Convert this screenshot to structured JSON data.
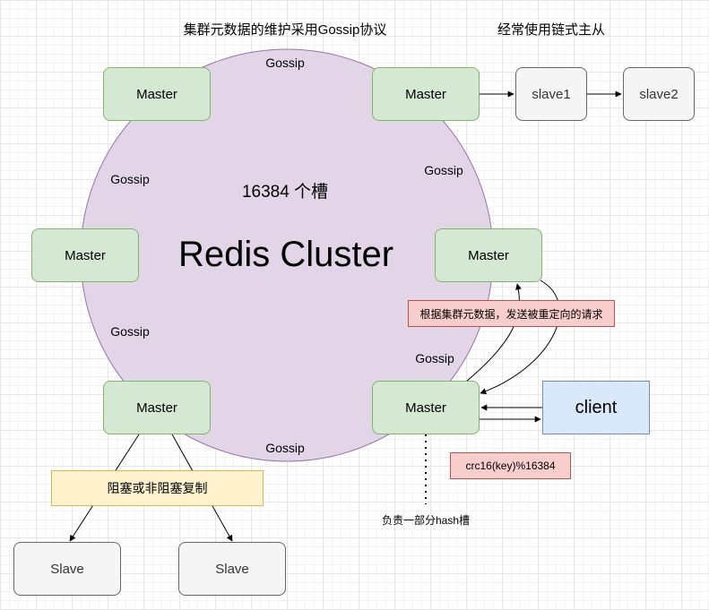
{
  "titles": {
    "gossip_meta": "集群元数据的维护采用Gossip协议",
    "chain": "经常使用链式主从"
  },
  "cluster": {
    "name": "Redis Cluster",
    "slots": "16384 个槽"
  },
  "nodes": {
    "master": "Master",
    "slave": "Slave",
    "slave1": "slave1",
    "slave2": "slave2",
    "client": "client"
  },
  "gossip": "Gossip",
  "notes": {
    "redirect": "根据集群元数据，发送被重定向的请求",
    "crc": "crc16(key)%16384",
    "replication": "阻塞或非阻塞复制",
    "hash_slot": "负责一部分hash槽"
  },
  "colors": {
    "cluster_fill": "#e1d5e7",
    "cluster_stroke": "#9673a6",
    "master_fill": "#d5e8d4",
    "master_stroke": "#82b366",
    "client_fill": "#dae8fc",
    "client_stroke": "#6c8ebf",
    "red_note_fill": "#f8cecc",
    "yellow_note_fill": "#fff2cc"
  }
}
